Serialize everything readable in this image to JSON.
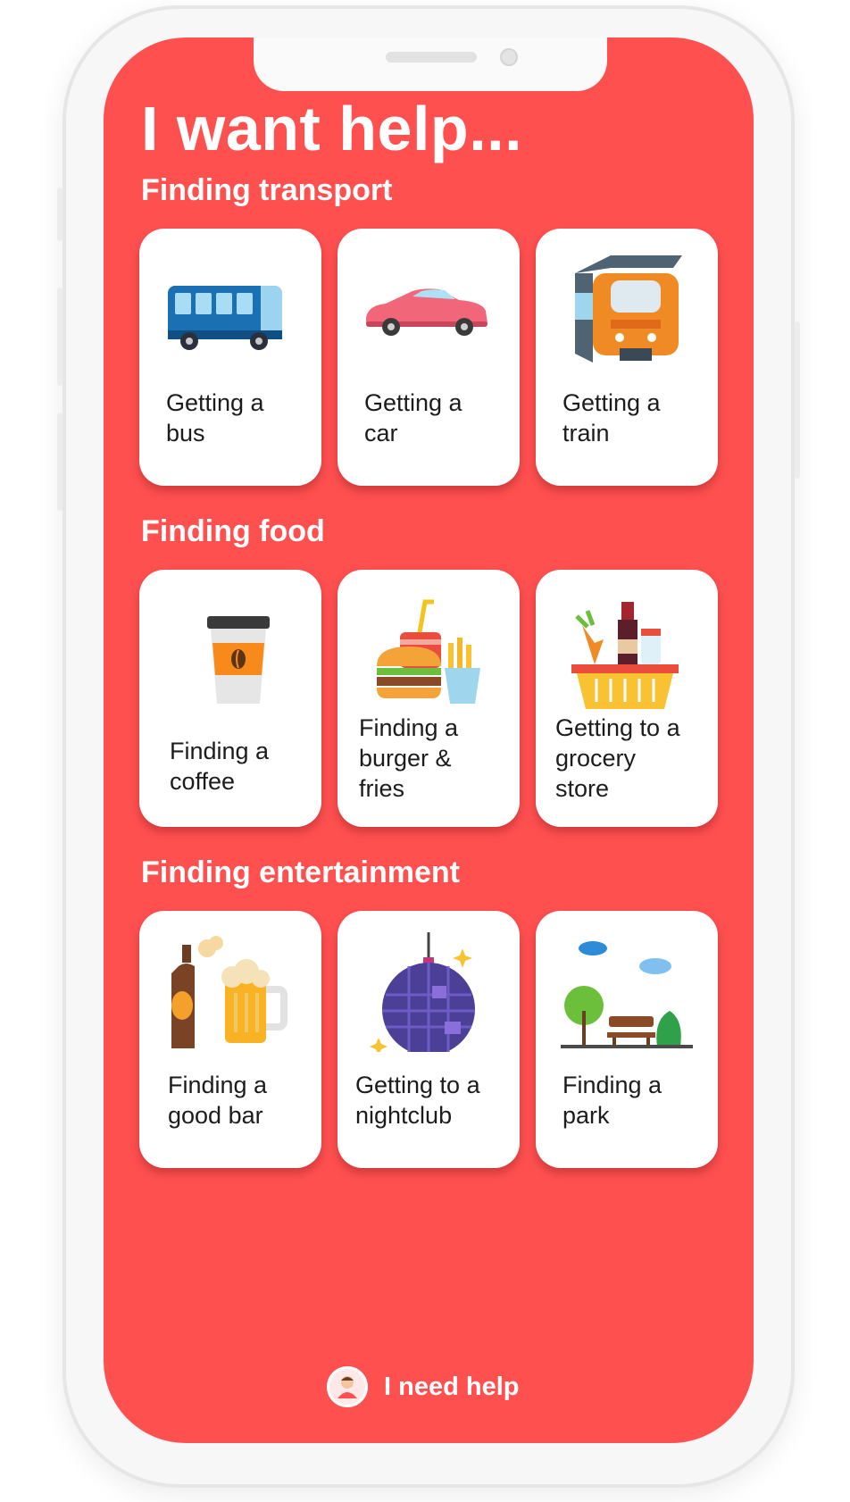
{
  "page": {
    "title": "I want help..."
  },
  "sections": [
    {
      "heading": "Finding transport",
      "items": [
        {
          "label": "Getting a\nbus",
          "icon": "bus-icon"
        },
        {
          "label": "Getting a\ncar",
          "icon": "car-icon"
        },
        {
          "label": "Getting a\ntrain",
          "icon": "train-icon"
        }
      ]
    },
    {
      "heading": "Finding food",
      "items": [
        {
          "label": "Finding a\ncoffee",
          "icon": "coffee-icon"
        },
        {
          "label": "Finding a\nburger &\nfries",
          "icon": "burger-fries-icon"
        },
        {
          "label": "Getting to a\ngrocery\nstore",
          "icon": "grocery-basket-icon"
        }
      ]
    },
    {
      "heading": "Finding entertainment",
      "items": [
        {
          "label": "Finding a\ngood bar",
          "icon": "beer-icon"
        },
        {
          "label": "Getting to a\nnightclub",
          "icon": "disco-ball-icon"
        },
        {
          "label": "Finding a\npark",
          "icon": "park-icon"
        }
      ]
    }
  ],
  "help_button": {
    "label": "I need help",
    "icon": "person-shrugging-icon"
  },
  "colors": {
    "background": "#ff5050",
    "card": "#ffffff",
    "text": "#1c1c1c"
  }
}
